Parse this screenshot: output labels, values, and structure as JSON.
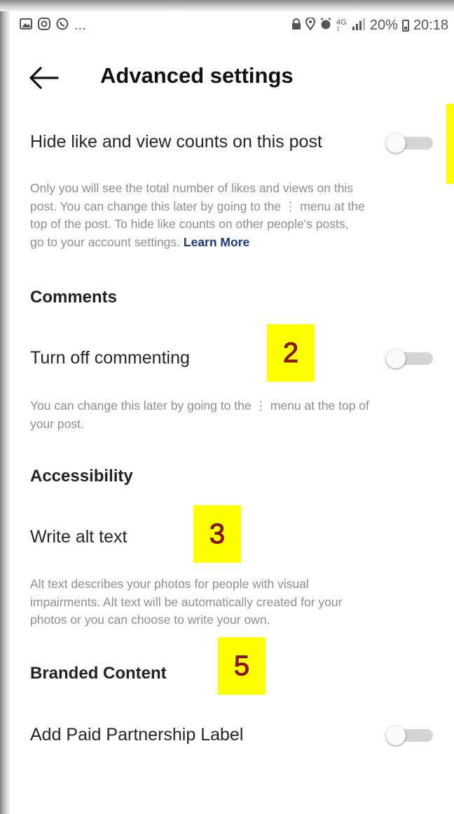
{
  "status_bar": {
    "left_icons": [
      "gallery-icon",
      "instagram-icon",
      "whatsapp-icon"
    ],
    "more": "...",
    "right_icons": [
      "lock-icon",
      "location-icon",
      "alarm-icon",
      "network-4g-icon",
      "signal-icon"
    ],
    "battery": "20%",
    "time": "20:18"
  },
  "header": {
    "title": "Advanced settings",
    "back_icon": "back-arrow-icon"
  },
  "hide_counts": {
    "label": "Hide like and view counts on this post",
    "toggle_on": false,
    "desc_1": "Only you will see the total number of likes and views on this",
    "desc_2": "post. You can change this later by going to the",
    "desc_2b": "menu at the",
    "desc_3": "top of the post. To hide like counts on other people's posts,",
    "desc_4": "go to your account settings.",
    "learn_more": "Learn More"
  },
  "comments": {
    "section_title": "Comments",
    "label": "Turn off commenting",
    "toggle_on": false,
    "desc_1": "You can change this later by going to the",
    "desc_1b": "menu at the top of",
    "desc_2": "your post."
  },
  "accessibility": {
    "section_title": "Accessibility",
    "label": "Write alt text",
    "desc_1": "Alt text describes your photos for people with visual",
    "desc_2": "impairments. Alt text will be automatically created for your",
    "desc_3": "photos or you can choose to write your own."
  },
  "branded": {
    "section_title": "Branded Content",
    "label": "Add Paid Partnership Label",
    "toggle_on": false
  },
  "annotations": [
    "2",
    "3",
    "5"
  ],
  "colors": {
    "highlight": "#ffff00",
    "annotation_text": "#d00000",
    "link": "#1a3a7a",
    "muted_text": "#8e8e8e"
  }
}
